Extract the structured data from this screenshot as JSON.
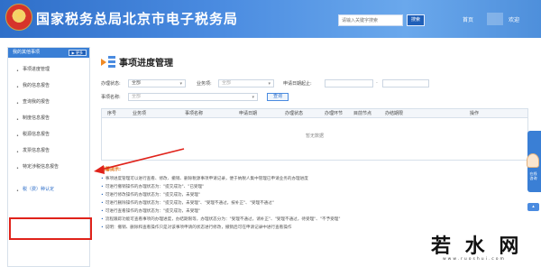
{
  "header": {
    "title": "国家税务总局北京市电子税务局",
    "subtitle": "北京市电子税务局",
    "search_placeholder": "请输入关键字搜索",
    "search_label": "搜索",
    "link_home": "首页",
    "link_user": "欢迎",
    "bg_color": "#3a7fd5"
  },
  "sidebar": {
    "header_label": "我的其他事项",
    "header_button": "▶ 更多",
    "items": [
      {
        "label": "事项进度管理"
      },
      {
        "label": "我的信息报告"
      },
      {
        "label": "查询我的报告"
      },
      {
        "label": "制度信息报告"
      },
      {
        "label": "税源信息报告"
      },
      {
        "label": "发票信息报告"
      },
      {
        "label": "特定涉税信息报告"
      },
      {
        "label": "税（费）种认定"
      }
    ]
  },
  "main": {
    "title": "事项进度管理",
    "filters": {
      "status_label": "办理状态:",
      "status_value": "全部",
      "biz_label": "业务项:",
      "biz_value": "全部",
      "date_label": "申请日期起止:",
      "date_from": "",
      "date_to": "",
      "name_label": "事项名称:",
      "name_value": "全部",
      "query_button": "查询"
    },
    "columns": [
      "序号",
      "业务项",
      "事项名称",
      "申请日期",
      "办理状态",
      "办理环节",
      "目前节点",
      "办结期限",
      "操作"
    ],
    "empty_text": "暂无数据",
    "notes_heading": "温馨提示:",
    "notes": [
      "事项进度管理可以进行查看、修改、撤销、删除税源事项申请记录，便于纳税人集中管理已申请业务的办理进度",
      "可进行撤销操作的办理状态为：\"提交成功\"、\"已受理\"",
      "可进行修改操作的办理状态为：\"提交成功，未受理\"",
      "可进行删除操作的办理状态为：\"提交成功，未受理\"、\"受理不通过，按补正\"、\"受理不通过\"",
      "可进行查看操作的办理状态为：\"提交成功，未受理\"",
      "流程跟踪功能可查看事项的办理进度，办结期限等，办理状态分为：\"受理不通过，请补正\"、\"受理不通过，待受理\"、\"不予受理\"",
      "说明：撤销、删除和查看操作只是对该事项申请的状态进行修改，撤销后可在申请记录中进行查看操作"
    ]
  },
  "float_tab": {
    "label": "在线咨询"
  },
  "watermark": {
    "text": "若 水 网",
    "url": "www.ruoshui.com"
  }
}
